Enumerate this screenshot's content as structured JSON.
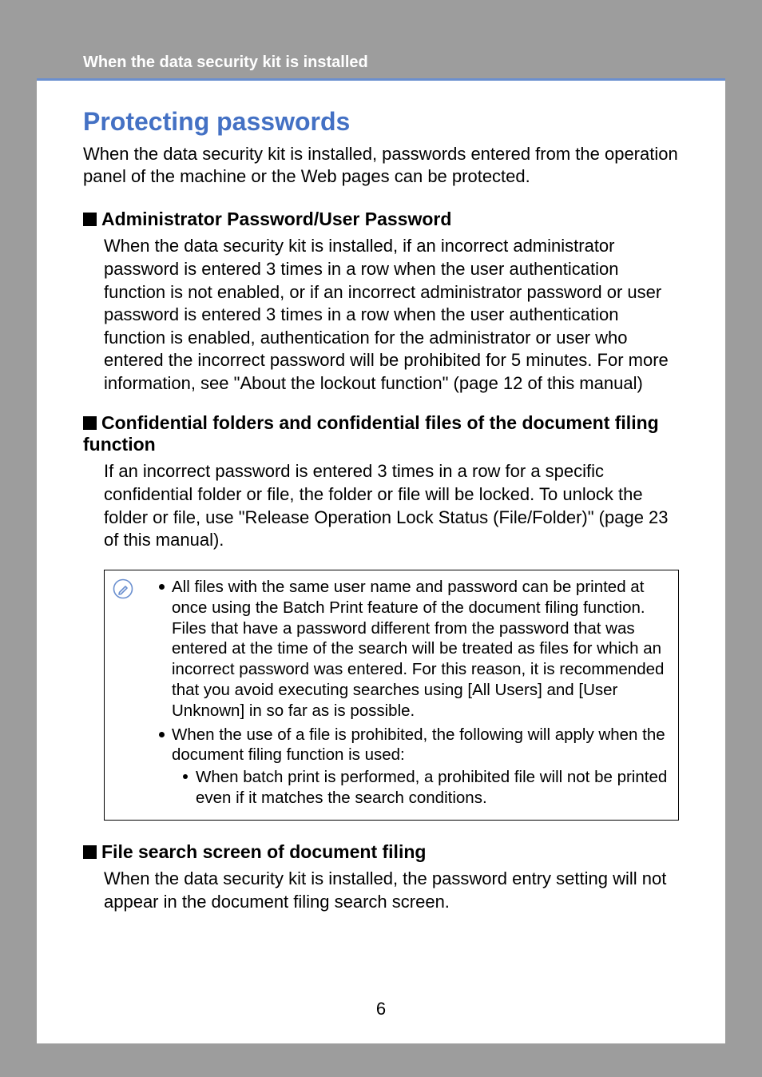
{
  "header": {
    "running_title": "When the data security kit is installed"
  },
  "main": {
    "title": "Protecting passwords",
    "intro": "When the data security kit is installed, passwords entered from the operation panel of the machine or the Web pages can be protected.",
    "section1": {
      "heading": "Administrator Password/User Password",
      "body": "When the data security kit is installed, if an incorrect administrator password is entered 3 times in a row when the user authentication function is not enabled, or if an incorrect administrator password or user password is entered 3 times in a row when the user authentication function is enabled, authentication for the administrator or user who entered the incorrect password will be prohibited for 5 minutes. For more information, see \"About the lockout function\" (page 12 of this manual)"
    },
    "section2": {
      "heading": "Confidential folders and confidential files of the document filing function",
      "body": "If an incorrect password is entered 3 times in a row for a specific confidential folder or file, the folder or file will be locked. To unlock the folder or file, use \"Release Operation Lock Status (File/Folder)\" (page 23 of this manual).",
      "note_items": [
        "All files with the same user name and password can be printed at once using the Batch Print feature of the document filing function. Files that have a password different from the password that was entered at the time of the search will be treated as files for which an incorrect password was entered.  For this reason, it is recommended that you avoid executing searches using [All Users] and [User Unknown] in so far as is possible.",
        "When the use of a file is prohibited, the following will apply when the document filing function is used:"
      ],
      "note_subitem": "When batch print is performed, a prohibited file will not be printed even if it matches the search conditions."
    },
    "section3": {
      "heading": "File search screen of document filing",
      "body": "When the data security kit is installed, the password entry setting will not appear in the document filing search screen."
    }
  },
  "page_number": "6"
}
